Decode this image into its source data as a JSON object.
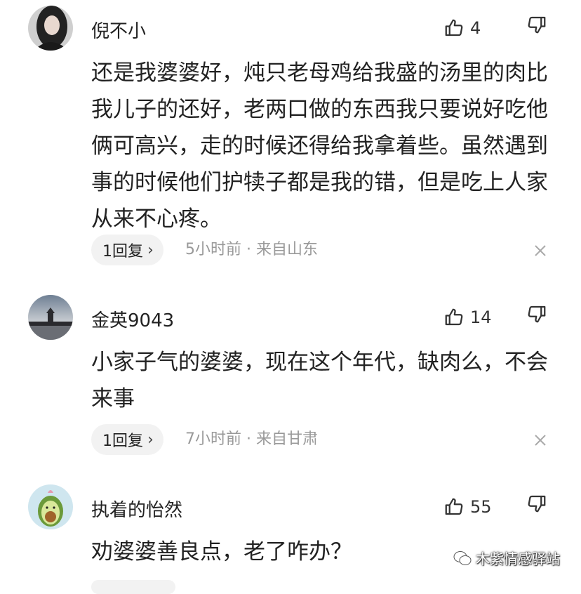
{
  "comments": [
    {
      "username": "倪不小",
      "likes": "4",
      "text": "还是我婆婆好，炖只老母鸡给我盛的汤里的肉比我儿子的还好，老两口做的东西我只要说好吃他俩可高兴，走的时候还得给我拿着些。虽然遇到事的时候他们护犊子都是我的错，但是吃上人家从来不心疼。",
      "reply_label": "1回复",
      "meta": "5小时前 · 来自山东"
    },
    {
      "username": "金英9043",
      "likes": "14",
      "text": "小家子气的婆婆，现在这个年代，缺肉么，不会来事",
      "reply_label": "1回复",
      "meta": "7小时前 · 来自甘肃"
    },
    {
      "username": "执着的怡然",
      "likes": "55",
      "text": "劝婆婆善良点，老了咋办？"
    }
  ],
  "watermark": "木紫情感驿站",
  "icons": {
    "like": "thumbs-up-icon",
    "dislike": "thumbs-down-icon",
    "close": "close-icon",
    "chevron": "chevron-right-icon"
  }
}
